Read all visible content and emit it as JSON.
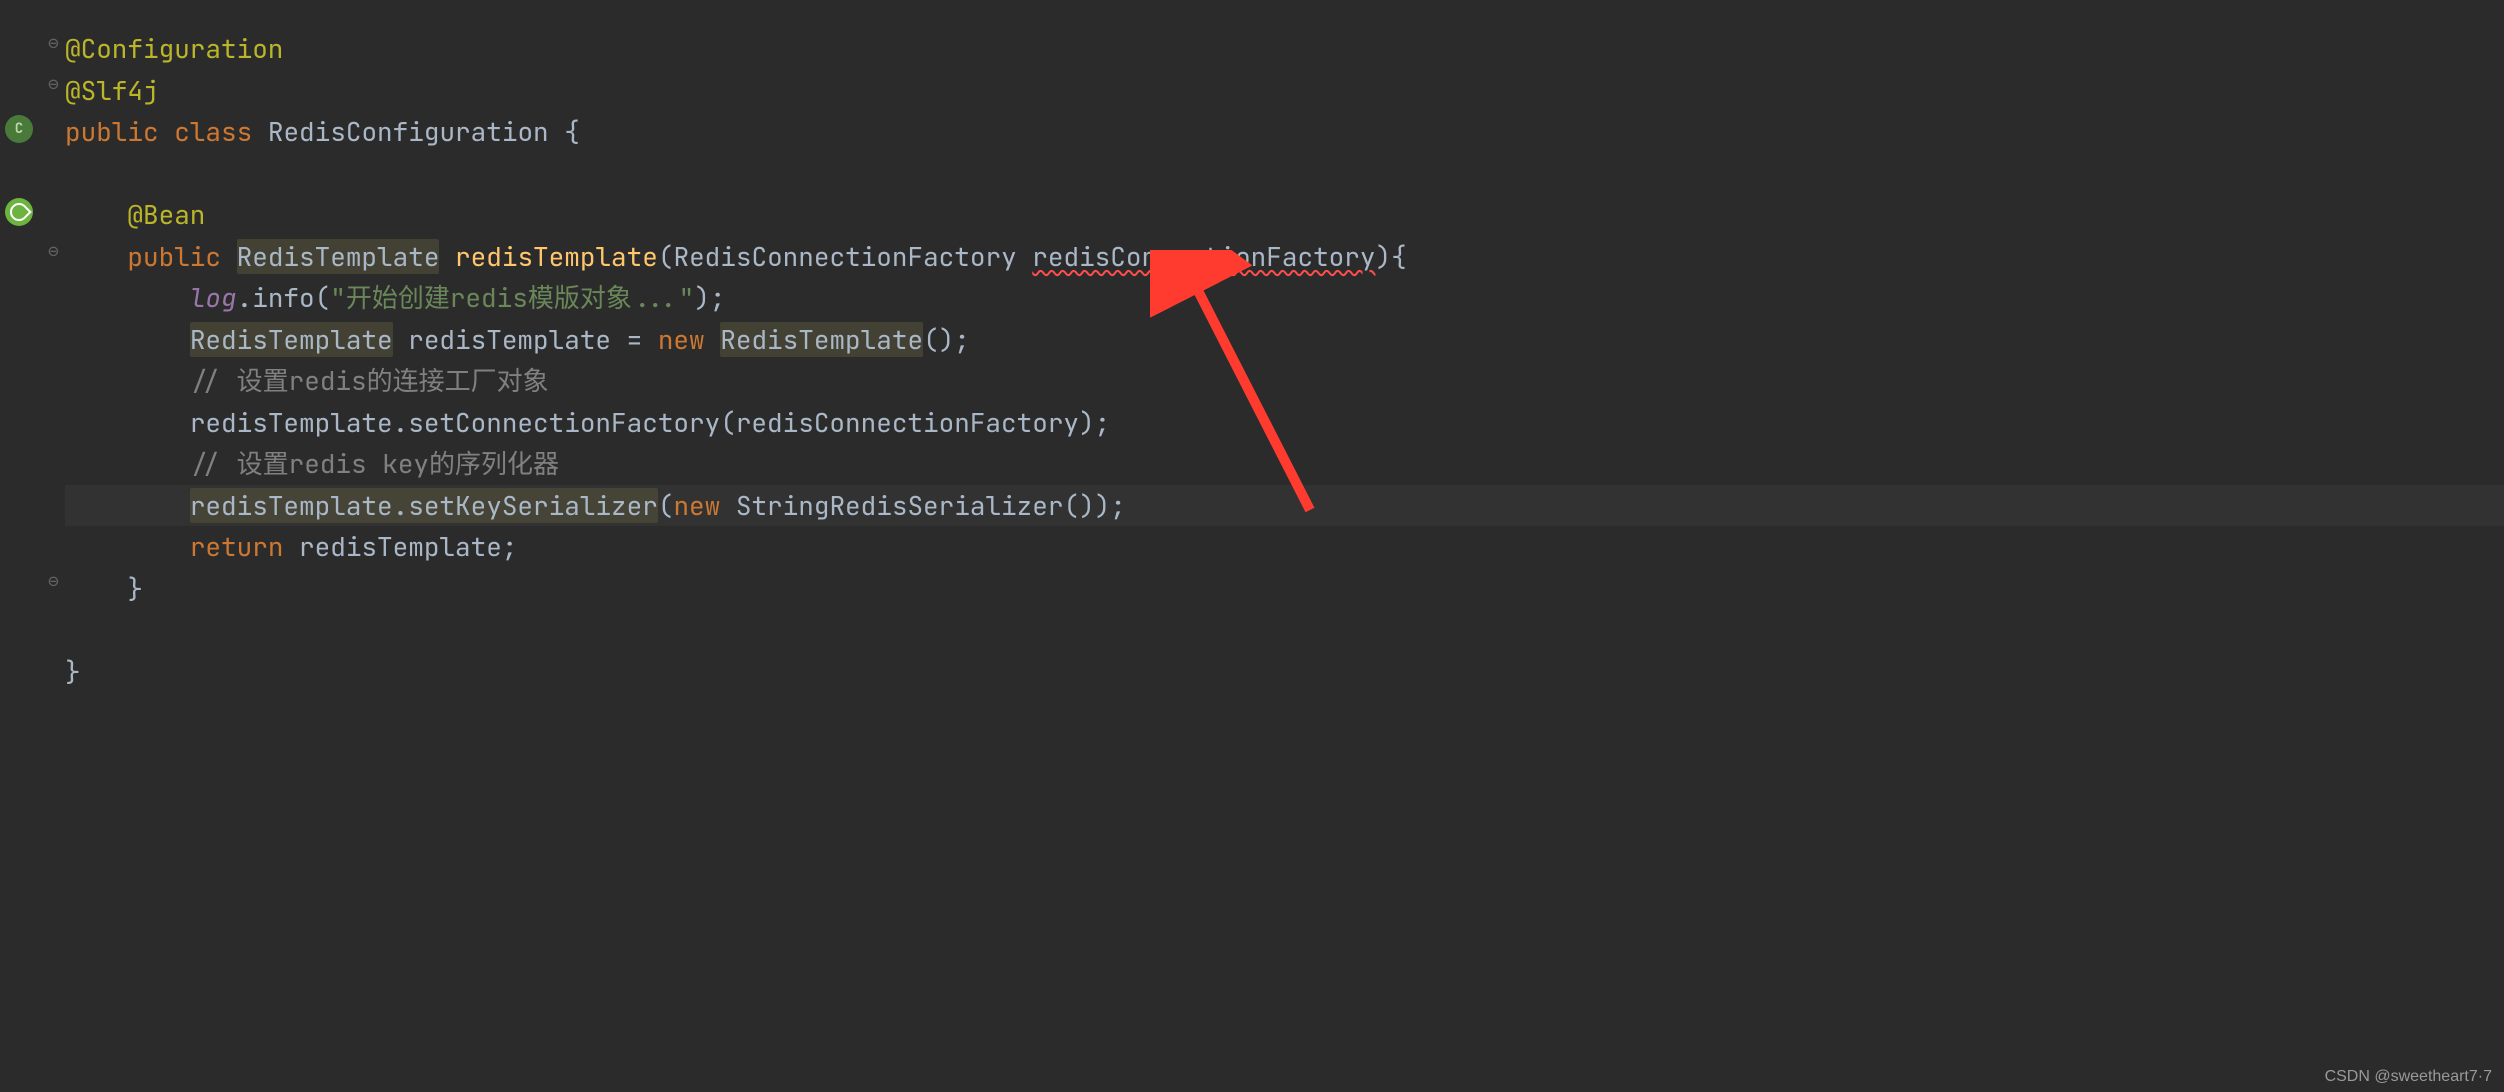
{
  "code": {
    "annotation_configuration": "@Configuration",
    "annotation_slf4j": "@Slf4j",
    "kw_public": "public",
    "kw_class": "class",
    "class_name": "RedisConfiguration",
    "brace_open": " {",
    "annotation_bean": "@Bean",
    "return_type": "RedisTemplate",
    "method_name": "redisTemplate",
    "param_type": "RedisConnectionFactory",
    "param_name": "redisConnectionFactory",
    "method_sig_end": "){",
    "log_var": "log",
    "info_call_open": ".info(",
    "log_string": "\"开始创建redis模版对象...\"",
    "info_call_close": ");",
    "type_redistemplate": "RedisTemplate",
    "var_redistemplate": " redisTemplate = ",
    "kw_new": "new",
    "ctor_redistemplate": "RedisTemplate",
    "ctor_end": "();",
    "comment1": "// 设置redis的连接工厂对象",
    "set_conn_factory": "redisTemplate.setConnectionFactory(redisConnectionFactory);",
    "comment2": "// 设置redis key的序列化器",
    "set_key_ser_call": "redisTemplate.setKeySerializer",
    "set_key_ser_open": "(",
    "ctor_serializer": "StringRedisSerializer",
    "ctor_serializer_end": "());",
    "kw_return": "return",
    "return_var": " redisTemplate;",
    "brace_close": "}"
  },
  "watermark": "CSDN @sweetheart7·7",
  "fold_symbols": {
    "top": "⊖",
    "mid": "⊖",
    "bottom": "⊖"
  }
}
